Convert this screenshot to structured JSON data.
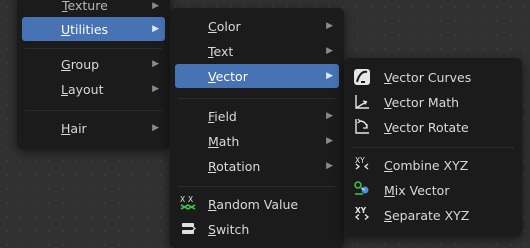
{
  "menu1": {
    "partial_top": "Texture",
    "items": [
      {
        "label": "Utilities",
        "active": true
      },
      {
        "label": "Group"
      },
      {
        "label": "Layout"
      },
      {
        "label": "Hair"
      }
    ]
  },
  "menu2": {
    "items": [
      {
        "label": "Color"
      },
      {
        "label": "Text"
      },
      {
        "label": "Vector",
        "active": true
      },
      {
        "label": "Field"
      },
      {
        "label": "Math"
      },
      {
        "label": "Rotation"
      },
      {
        "label": "Random Value",
        "icon": "random-value-icon"
      },
      {
        "label": "Switch",
        "icon": "switch-icon"
      }
    ]
  },
  "menu3": {
    "items": [
      {
        "label": "Vector Curves",
        "icon": "vector-curves-icon"
      },
      {
        "label": "Vector Math",
        "icon": "vector-math-icon"
      },
      {
        "label": "Vector Rotate",
        "icon": "vector-rotate-icon"
      },
      {
        "label": "Combine XYZ",
        "icon": "combine-xyz-icon"
      },
      {
        "label": "Mix Vector",
        "icon": "mix-vector-icon"
      },
      {
        "label": "Separate XYZ",
        "icon": "separate-xyz-icon"
      }
    ]
  },
  "colors": {
    "menu_bg": "#1b1b1b",
    "highlight": "#4772b3",
    "canvas_bg": "#313131",
    "text": "#d9d9d9"
  }
}
